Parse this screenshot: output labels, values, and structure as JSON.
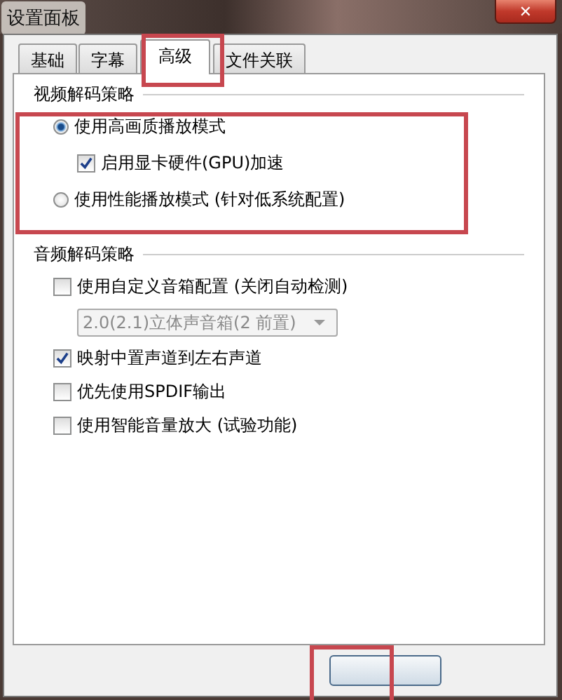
{
  "window": {
    "title": "设置面板",
    "close_glyph": "✕"
  },
  "tabs": [
    {
      "label": "基础",
      "selected": false
    },
    {
      "label": "字幕",
      "selected": false
    },
    {
      "label": "高级",
      "selected": true
    },
    {
      "label": "文件关联",
      "selected": false
    }
  ],
  "video_group": {
    "label": "视频解码策略",
    "options": [
      {
        "kind": "radio",
        "label": "使用高画质播放模式",
        "selected": true,
        "children": [
          {
            "kind": "checkbox",
            "label": "启用显卡硬件(GPU)加速",
            "checked": true
          }
        ]
      },
      {
        "kind": "radio",
        "label": "使用性能播放模式 (针对低系统配置)",
        "selected": false
      }
    ]
  },
  "audio_group": {
    "label": "音频解码策略",
    "options": [
      {
        "kind": "checkbox",
        "label": "使用自定义音箱配置 (关闭自动检测)",
        "checked": false,
        "children": [
          {
            "kind": "dropdown",
            "value": "2.0(2.1)立体声音箱(2 前置)",
            "disabled": true
          }
        ]
      },
      {
        "kind": "checkbox",
        "label": "映射中置声道到左右声道",
        "checked": true
      },
      {
        "kind": "checkbox",
        "label": "优先使用SPDIF输出",
        "checked": false
      },
      {
        "kind": "checkbox",
        "label": "使用智能音量放大 (试验功能)",
        "checked": false
      }
    ]
  }
}
